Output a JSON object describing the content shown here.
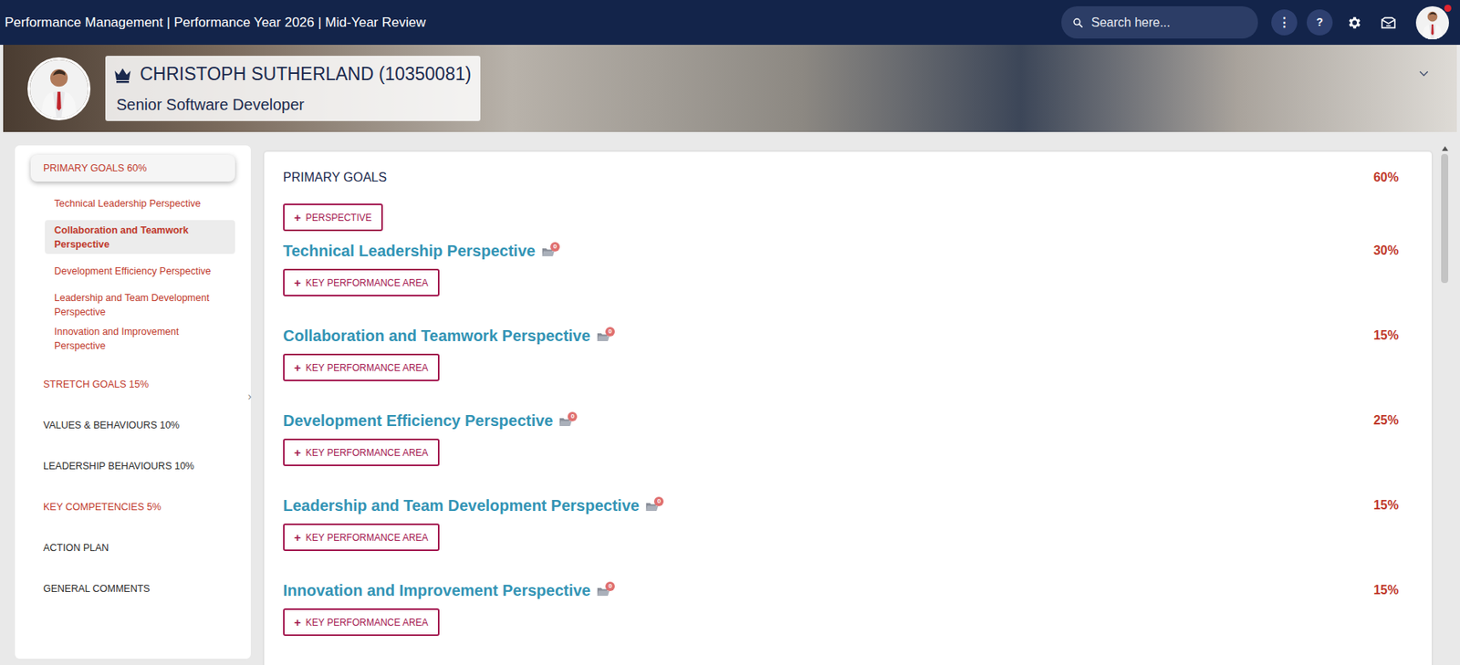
{
  "header": {
    "title": "Performance Management | Performance Year 2026 | Mid-Year Review",
    "search": {
      "placeholder": "Search here..."
    },
    "more_glyph": "⋮",
    "help_glyph": "?",
    "has_notification": true
  },
  "profile": {
    "name": "CHRISTOPH SUTHERLAND (10350081)",
    "role": "Senior Software Developer"
  },
  "collapse_glyph": "›",
  "nav": [
    {
      "label": "PRIMARY GOALS 60%",
      "color": "#c0392b",
      "selected": true,
      "children": [
        {
          "label": "Technical Leadership Perspective",
          "selected": false
        },
        {
          "label": "Collaboration and Teamwork Perspective",
          "selected": true
        },
        {
          "label": "Development Efficiency Perspective",
          "selected": false
        },
        {
          "label": "Leadership and Team Development Perspective",
          "selected": false
        },
        {
          "label": "Innovation and Improvement Perspective",
          "selected": false
        }
      ]
    },
    {
      "label": "STRETCH GOALS 15%",
      "color": "#c0392b",
      "selected": false,
      "children": []
    },
    {
      "label": "VALUES & BEHAVIOURS 10%",
      "color": "#2b2b2b",
      "selected": false,
      "children": []
    },
    {
      "label": "LEADERSHIP BEHAVIOURS 10%",
      "color": "#2b2b2b",
      "selected": false,
      "children": []
    },
    {
      "label": "KEY COMPETENCIES 5%",
      "color": "#c0392b",
      "selected": false,
      "children": []
    },
    {
      "label": "ACTION PLAN",
      "color": "#2b2b2b",
      "selected": false,
      "children": []
    },
    {
      "label": "GENERAL COMMENTS",
      "color": "#2b2b2b",
      "selected": false,
      "children": []
    }
  ],
  "section": {
    "title": "PRIMARY GOALS",
    "weight": "60%",
    "add_icon": "+",
    "add_label": "PERSPECTIVE"
  },
  "perspectives": [
    {
      "title": "Technical Leadership Perspective",
      "weight": "30%",
      "count": "0",
      "add_icon": "+",
      "button": "KEY PERFORMANCE AREA"
    },
    {
      "title": "Collaboration and Teamwork Perspective",
      "weight": "15%",
      "count": "0",
      "add_icon": "+",
      "button": "KEY PERFORMANCE AREA"
    },
    {
      "title": "Development Efficiency Perspective",
      "weight": "25%",
      "count": "0",
      "add_icon": "+",
      "button": "KEY PERFORMANCE AREA"
    },
    {
      "title": "Leadership and Team Development Perspective",
      "weight": "15%",
      "count": "0",
      "add_icon": "+",
      "button": "KEY PERFORMANCE AREA"
    },
    {
      "title": "Innovation and Improvement Perspective",
      "weight": "15%",
      "count": "0",
      "add_icon": "+",
      "button": "KEY PERFORMANCE AREA"
    }
  ]
}
